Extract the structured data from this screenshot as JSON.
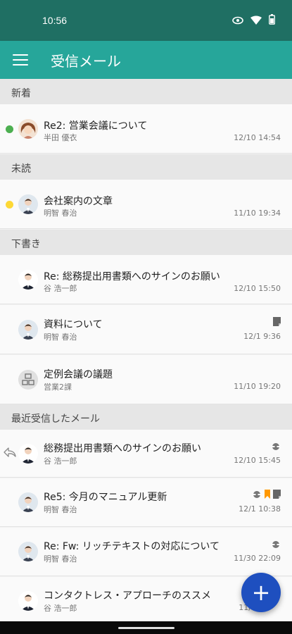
{
  "status_bar": {
    "time": "10:56"
  },
  "app_bar": {
    "title": "受信メール"
  },
  "sections": [
    {
      "label": "新着"
    },
    {
      "label": "未読"
    },
    {
      "label": "下書き"
    },
    {
      "label": "最近受信したメール"
    }
  ],
  "mails": [
    {
      "subject": "Re2: 営業会議について",
      "sender": "半田 優衣",
      "date": "12/10 14:54",
      "dot_color": "#4caf50"
    },
    {
      "subject": "会社案内の文章",
      "sender": "明智 春治",
      "date": "11/10 19:34",
      "dot_color": "#fdd835"
    },
    {
      "subject": "Re: 総務提出用書類へのサインのお願い",
      "sender": "谷 浩一郎",
      "date": "12/10 15:50"
    },
    {
      "subject": "資料について",
      "sender": "明智 春治",
      "date": "12/1 9:36"
    },
    {
      "subject": "定例会議の議題",
      "sender": "営業2課",
      "date": "11/10 19:20"
    },
    {
      "subject": "総務提出用書類へのサインのお願い",
      "sender": "谷 浩一郎",
      "date": "12/10 15:45"
    },
    {
      "subject": "Re5: 今月のマニュアル更新",
      "sender": "明智 春治",
      "date": "12/1 10:38"
    },
    {
      "subject": "Re: Fw: リッチテキストの対応について",
      "sender": "明智 春治",
      "date": "11/30 22:09"
    },
    {
      "subject": "コンタクトレス・アプローチのススメ",
      "sender": "谷 浩一郎",
      "date": "11/"
    }
  ],
  "fab": {
    "label": "+"
  },
  "colors": {
    "status_bar": "#1f6f63",
    "app_bar": "#26a69a",
    "fab": "#1e4fbf",
    "bookmark": "#ff9800"
  }
}
